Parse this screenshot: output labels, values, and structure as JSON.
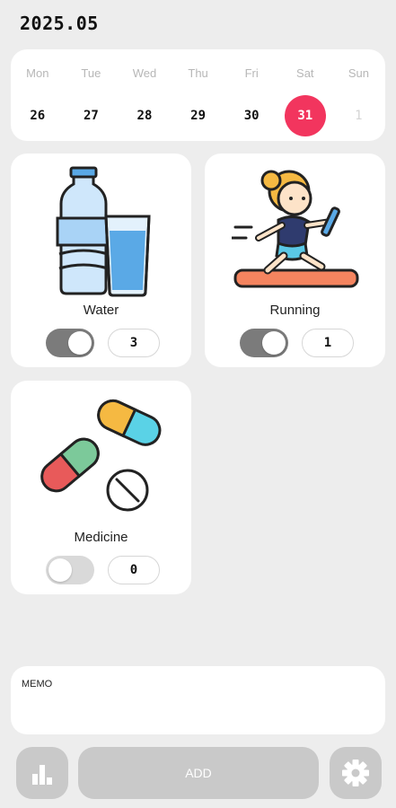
{
  "header": {
    "title": "2025.05"
  },
  "calendar": {
    "days": [
      {
        "dow": "Mon",
        "date": "26"
      },
      {
        "dow": "Tue",
        "date": "27"
      },
      {
        "dow": "Wed",
        "date": "28"
      },
      {
        "dow": "Thu",
        "date": "29"
      },
      {
        "dow": "Fri",
        "date": "30"
      },
      {
        "dow": "Sat",
        "date": "31",
        "selected": true
      },
      {
        "dow": "Sun",
        "date": "1",
        "muted": true
      }
    ],
    "accent_color": "#f2355e"
  },
  "habits": [
    {
      "label": "Water",
      "count": "3",
      "enabled": true,
      "icon": "water-bottle-glass-icon"
    },
    {
      "label": "Running",
      "count": "1",
      "enabled": true,
      "icon": "runner-icon"
    },
    {
      "label": "Medicine",
      "count": "0",
      "enabled": false,
      "icon": "pills-icon"
    }
  ],
  "memo": {
    "label": "MEMO"
  },
  "toolbar": {
    "add_label": "ADD",
    "stats_icon": "bar-chart-icon",
    "settings_icon": "gear-icon"
  }
}
